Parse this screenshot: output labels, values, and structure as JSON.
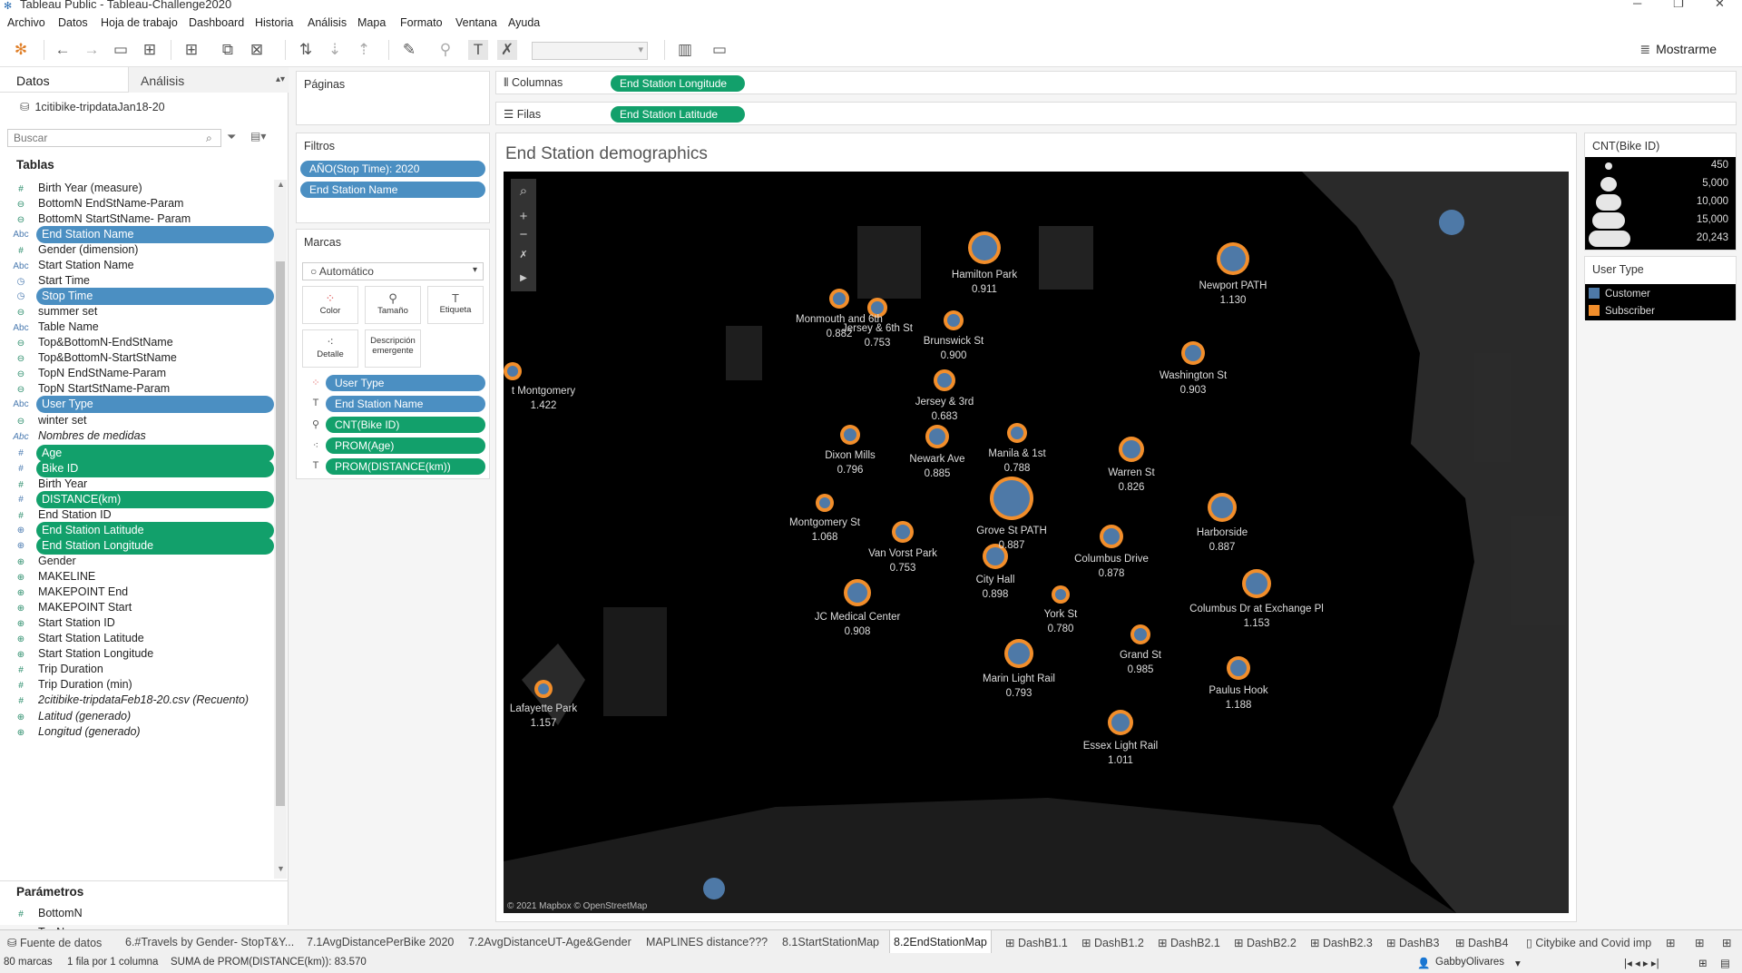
{
  "window": {
    "title": "Tableau Public - Tableau-Challenge2020"
  },
  "menu": [
    "Archivo",
    "Datos",
    "Hoja de trabajo",
    "Dashboard",
    "Historia",
    "Análisis",
    "Mapa",
    "Formato",
    "Ventana",
    "Ayuda"
  ],
  "toolbar": {
    "show_me": "Mostrarme"
  },
  "data_pane": {
    "tab_data": "Datos",
    "tab_analysis": "Análisis",
    "datasource": "1citibike-tripdataJan18-20",
    "search_placeholder": "Buscar",
    "tables_title": "Tablas",
    "params_title": "Parámetros",
    "fields": [
      {
        "label": "Birth Year (measure)",
        "icon": "#"
      },
      {
        "label": "BottomN EndStName-Param",
        "icon": "⊖"
      },
      {
        "label": "BottomN StartStName- Param",
        "icon": "⊖"
      },
      {
        "label": "End Station Name",
        "icon": "Abc"
      },
      {
        "label": "Gender (dimension)",
        "icon": "#"
      },
      {
        "label": "Start Station Name",
        "icon": "Abc"
      },
      {
        "label": "Start Time",
        "icon": "◷"
      },
      {
        "label": "Stop Time",
        "icon": "◷"
      },
      {
        "label": "summer set",
        "icon": "⊖"
      },
      {
        "label": "Table Name",
        "icon": "Abc"
      },
      {
        "label": "Top&BottomN-EndStName",
        "icon": "⊖"
      },
      {
        "label": "Top&BottomN-StartStName",
        "icon": "⊖"
      },
      {
        "label": "TopN EndStName-Param",
        "icon": "⊖"
      },
      {
        "label": "TopN StartStName-Param",
        "icon": "⊖"
      },
      {
        "label": "User Type",
        "icon": "Abc"
      },
      {
        "label": "winter set",
        "icon": "⊖"
      },
      {
        "label": "Nombres de medidas",
        "icon": "Abc"
      },
      {
        "label": "Age",
        "icon": "#"
      },
      {
        "label": "Bike ID",
        "icon": "#"
      },
      {
        "label": "Birth Year",
        "icon": "#"
      },
      {
        "label": "DISTANCE(km)",
        "icon": "#"
      },
      {
        "label": "End Station ID",
        "icon": "#"
      },
      {
        "label": "End Station Latitude",
        "icon": "⊕"
      },
      {
        "label": "End Station Longitude",
        "icon": "⊕"
      },
      {
        "label": "Gender",
        "icon": "⊕"
      },
      {
        "label": "MAKELINE",
        "icon": "⊕"
      },
      {
        "label": "MAKEPOINT End",
        "icon": "⊕"
      },
      {
        "label": "MAKEPOINT Start",
        "icon": "⊕"
      },
      {
        "label": "Start Station ID",
        "icon": "⊕"
      },
      {
        "label": "Start Station Latitude",
        "icon": "⊕"
      },
      {
        "label": "Start Station Longitude",
        "icon": "⊕"
      },
      {
        "label": "Trip Duration",
        "icon": "#"
      },
      {
        "label": "Trip Duration (min)",
        "icon": "#"
      },
      {
        "label": "2citibike-tripdataFeb18-20.csv (Recuento)",
        "icon": "#"
      },
      {
        "label": "Latitud (generado)",
        "icon": "⊕"
      },
      {
        "label": "Longitud (generado)",
        "icon": "⊕"
      }
    ],
    "params": [
      "BottomN",
      "TopN"
    ]
  },
  "cards": {
    "pages": "Páginas",
    "filters": "Filtros",
    "filter_pills": [
      "AÑO(Stop Time): 2020",
      "End Station Name"
    ],
    "marks": "Marcas",
    "mark_type": "Automático",
    "mark_buttons": [
      "Color",
      "Tamaño",
      "Etiqueta",
      "Detalle",
      "Descripción emergente"
    ],
    "mark_pills": [
      "User Type",
      "End Station Name",
      "CNT(Bike ID)",
      "PROM(Age)",
      "PROM(DISTANCE(km))"
    ]
  },
  "shelves": {
    "columns_label": "Columnas",
    "columns_pill": "End Station Longitude",
    "rows_label": "Filas",
    "rows_pill": "End Station Latitude"
  },
  "viz": {
    "title": "End Station demographics",
    "copyright": "© 2021 Mapbox © OpenStreetMap",
    "stations": [
      {
        "name": "Hamilton Park",
        "value": "0.911"
      },
      {
        "name": "Newport PATH",
        "value": "1.130"
      },
      {
        "name": "Monmouth and 6th",
        "value": "0.882"
      },
      {
        "name": "Jersey & 6th St",
        "value": "0.753"
      },
      {
        "name": "Brunswick St",
        "value": "0.900"
      },
      {
        "name": "Washington St",
        "value": "0.903"
      },
      {
        "name": "t Montgomery",
        "value": "1.422"
      },
      {
        "name": "Jersey & 3rd",
        "value": "0.683"
      },
      {
        "name": "Dixon Mills",
        "value": "0.796"
      },
      {
        "name": "Newark Ave",
        "value": "0.885"
      },
      {
        "name": "Manila & 1st",
        "value": "0.788"
      },
      {
        "name": "Warren St",
        "value": "0.826"
      },
      {
        "name": "Montgomery St",
        "value": "1.068"
      },
      {
        "name": "Grove St PATH",
        "value": "0.887"
      },
      {
        "name": "Harborside",
        "value": "0.887"
      },
      {
        "name": "Van Vorst Park",
        "value": "0.753"
      },
      {
        "name": "Columbus Drive",
        "value": "0.878"
      },
      {
        "name": "City Hall",
        "value": "0.898"
      },
      {
        "name": "Columbus Dr at Exchange Pl",
        "value": "1.153"
      },
      {
        "name": "JC Medical Center",
        "value": "0.908"
      },
      {
        "name": "York St",
        "value": "0.780"
      },
      {
        "name": "Grand St",
        "value": "0.985"
      },
      {
        "name": "Marin Light Rail",
        "value": "0.793"
      },
      {
        "name": "Paulus Hook",
        "value": "1.188"
      },
      {
        "name": "Lafayette Park",
        "value": "1.157"
      },
      {
        "name": "Essex Light Rail",
        "value": "1.011"
      }
    ]
  },
  "size_legend": {
    "title": "CNT(Bike ID)",
    "entries": [
      "450",
      "5,000",
      "10,000",
      "15,000",
      "20,243"
    ]
  },
  "color_legend": {
    "title": "User Type",
    "entries": [
      {
        "label": "Customer",
        "color": "#4e79a7"
      },
      {
        "label": "Subscriber",
        "color": "#f28e2b"
      }
    ]
  },
  "sheet_tabs": [
    "Fuente de datos",
    "6.#Travels by Gender- StopT&Y...",
    "7.1AvgDistancePerBike 2020",
    "7.2AvgDistanceUT-Age&Gender",
    "MAPLINES distance???",
    "8.1StartStationMap",
    "8.2EndStationMap",
    "DashB1.1",
    "DashB1.2",
    "DashB2.1",
    "DashB2.2",
    "DashB2.3",
    "DashB3",
    "DashB4",
    "Citybike and Covid imp"
  ],
  "status": {
    "marks": "80 marcas",
    "rows_cols": "1 fila por 1 columna",
    "sum": "SUMA de PROM(DISTANCE(km)): 83.570",
    "user": "GabbyOlivares"
  }
}
